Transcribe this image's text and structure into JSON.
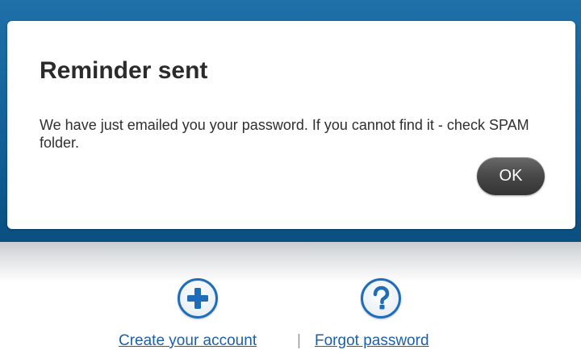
{
  "dialog": {
    "title": "Reminder sent",
    "message": "We have just emailed you your password. If you cannot find it - check SPAM folder.",
    "ok_label": "OK"
  },
  "footer": {
    "create_account_label": "Create your account",
    "separator": "|",
    "forgot_password_label": "Forgot password",
    "create_account_icon": "plus-circle-icon",
    "forgot_password_icon": "question-circle-icon"
  },
  "colors": {
    "header_blue": "#1f6fa8",
    "link_blue": "#1d5fa8",
    "icon_blue": "#1f6db8",
    "button_dark": "#4a4a4a"
  }
}
